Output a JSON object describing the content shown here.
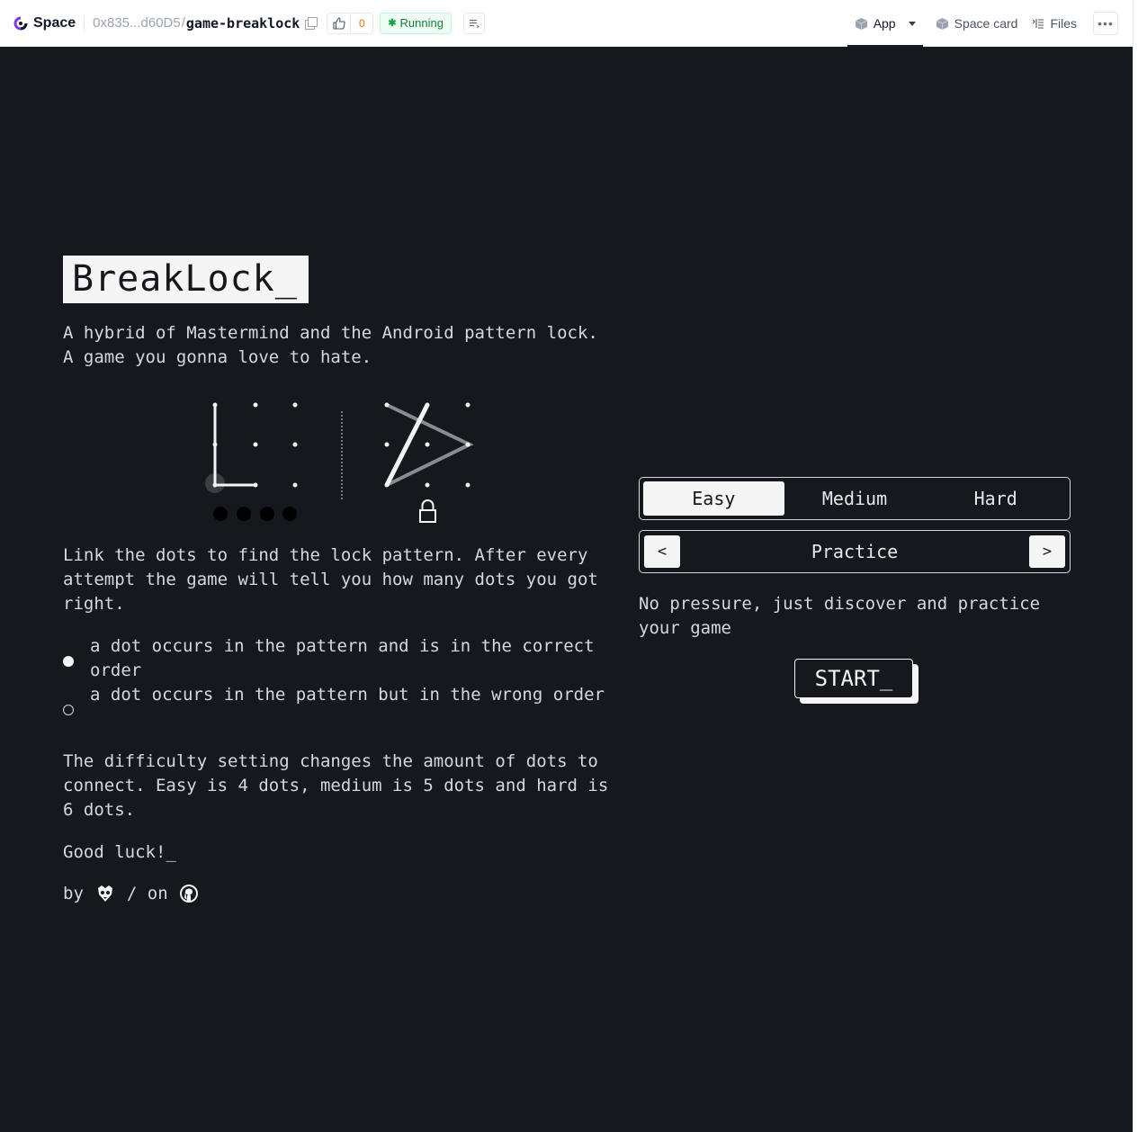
{
  "header": {
    "logo_text": "Space",
    "owner": "0x835...d60D5",
    "slash": "/",
    "repo": "game-breaklock",
    "like_count": "0",
    "status": "Running",
    "tabs": [
      {
        "label": "App",
        "icon": "cube-icon"
      },
      {
        "label": "Space card",
        "icon": "cube-icon"
      },
      {
        "label": "Files",
        "icon": "files-icon"
      }
    ],
    "more": "•••"
  },
  "game": {
    "title": "BreakLock_",
    "intro": "A hybrid of Mastermind and the Android pattern lock. A game you gonna love to hate.",
    "how_to": "Link the dots to find the lock pattern. After every attempt the game will tell you how many dots you got right.",
    "legend": [
      {
        "type": "full",
        "text": "a dot occurs in the pattern and is in the correct order"
      },
      {
        "type": "hollow",
        "text": "a dot occurs in the pattern but in the wrong order"
      }
    ],
    "difficulty_text": "The difficulty setting changes the amount of dots to connect. Easy is 4 dots, medium is 5 dots and hard is 6 dots.",
    "good_luck": "Good luck!_",
    "by": "by",
    "on": "/ on"
  },
  "controls": {
    "difficulties": [
      "Easy",
      "Medium",
      "Hard"
    ],
    "selected_difficulty": "Easy",
    "prev": "<",
    "mode": "Practice",
    "next": ">",
    "mode_description": "No pressure, just discover and practice your game",
    "start": "START_"
  },
  "colors": {
    "app_bg": "#15181c",
    "text": "#d6d8db",
    "accent_light": "#f5f5f5",
    "status_green": "#15803d"
  }
}
